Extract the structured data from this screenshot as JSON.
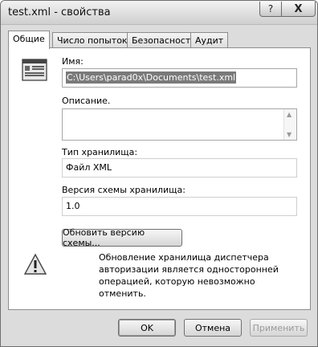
{
  "window": {
    "title": "test.xml - свойства"
  },
  "titlebar": {
    "help_glyph": "?",
    "close_glyph": "X"
  },
  "tabs": [
    {
      "label": "Общие",
      "active": true
    },
    {
      "label": "Число попыток",
      "active": false
    },
    {
      "label": "Безопасность",
      "active": false
    },
    {
      "label": "Аудит",
      "active": false
    }
  ],
  "general": {
    "name_label": "Имя:",
    "name_value": "C:\\Users\\parad0x\\Documents\\test.xml",
    "description_label": "Описание.",
    "description_value": "",
    "store_type_label": "Тип хранилища:",
    "store_type_value": "Файл XML",
    "schema_version_label": "Версия схемы хранилища:",
    "schema_version_value": "1.0",
    "update_schema_button": "Обновить версию схемы...",
    "warning_text": "Обновление хранилища диспетчера авторизации является односторонней операцией, которую невозможно отменить."
  },
  "footer": {
    "ok_label": "OK",
    "cancel_label": "Отмена",
    "apply_label": "Применить",
    "apply_enabled": false
  },
  "icons": {
    "store": "authorization-store-icon",
    "warning": "warning-icon",
    "help": "help-icon",
    "close": "close-icon"
  }
}
